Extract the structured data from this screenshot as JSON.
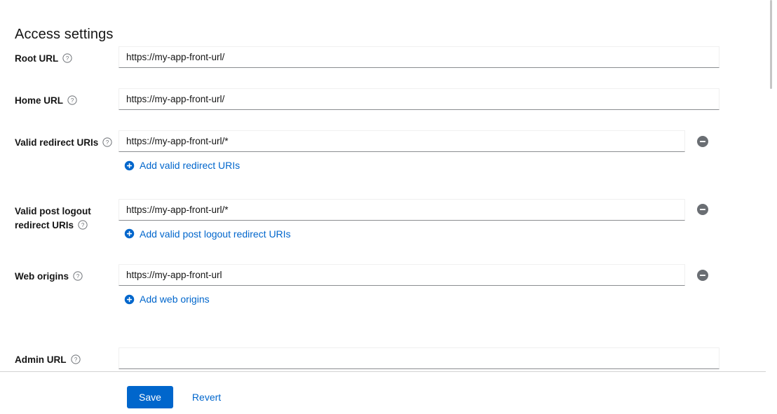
{
  "header": {
    "title": "Access settings"
  },
  "icons": {
    "help": "help-circle-icon",
    "add": "plus-circle-icon",
    "remove": "minus-circle-icon"
  },
  "colors": {
    "accent_blue": "#0066cc",
    "link_blue": "#0066cc",
    "remove_gray": "#6a6e73",
    "text": "#151515",
    "input_underline": "#8a8d90",
    "divider": "#d2d2d2"
  },
  "form": {
    "fields": [
      {
        "id": "root-url",
        "label": "Root URL",
        "value": "https://my-app-front-url/",
        "placeholder": "",
        "has_remove": false,
        "add_label": null
      },
      {
        "id": "home-url",
        "label": "Home URL",
        "value": "https://my-app-front-url/",
        "placeholder": "",
        "has_remove": false,
        "add_label": null
      },
      {
        "id": "valid-redirect-uris",
        "label": "Valid redirect URIs",
        "value": "https://my-app-front-url/*",
        "placeholder": "",
        "has_remove": true,
        "add_label": "Add valid redirect URIs"
      },
      {
        "id": "valid-post-logout-redirect-uris",
        "label": "Valid post logout redirect URIs",
        "value": "https://my-app-front-url/*",
        "placeholder": "",
        "has_remove": true,
        "add_label": "Add valid post logout redirect URIs"
      },
      {
        "id": "web-origins",
        "label": "Web origins",
        "value": "https://my-app-front-url",
        "placeholder": "",
        "has_remove": true,
        "add_label": "Add web origins"
      },
      {
        "id": "admin-url",
        "label": "Admin URL",
        "value": "",
        "placeholder": "",
        "has_remove": false,
        "add_label": null
      }
    ]
  },
  "footer": {
    "save_label": "Save",
    "revert_label": "Revert"
  }
}
